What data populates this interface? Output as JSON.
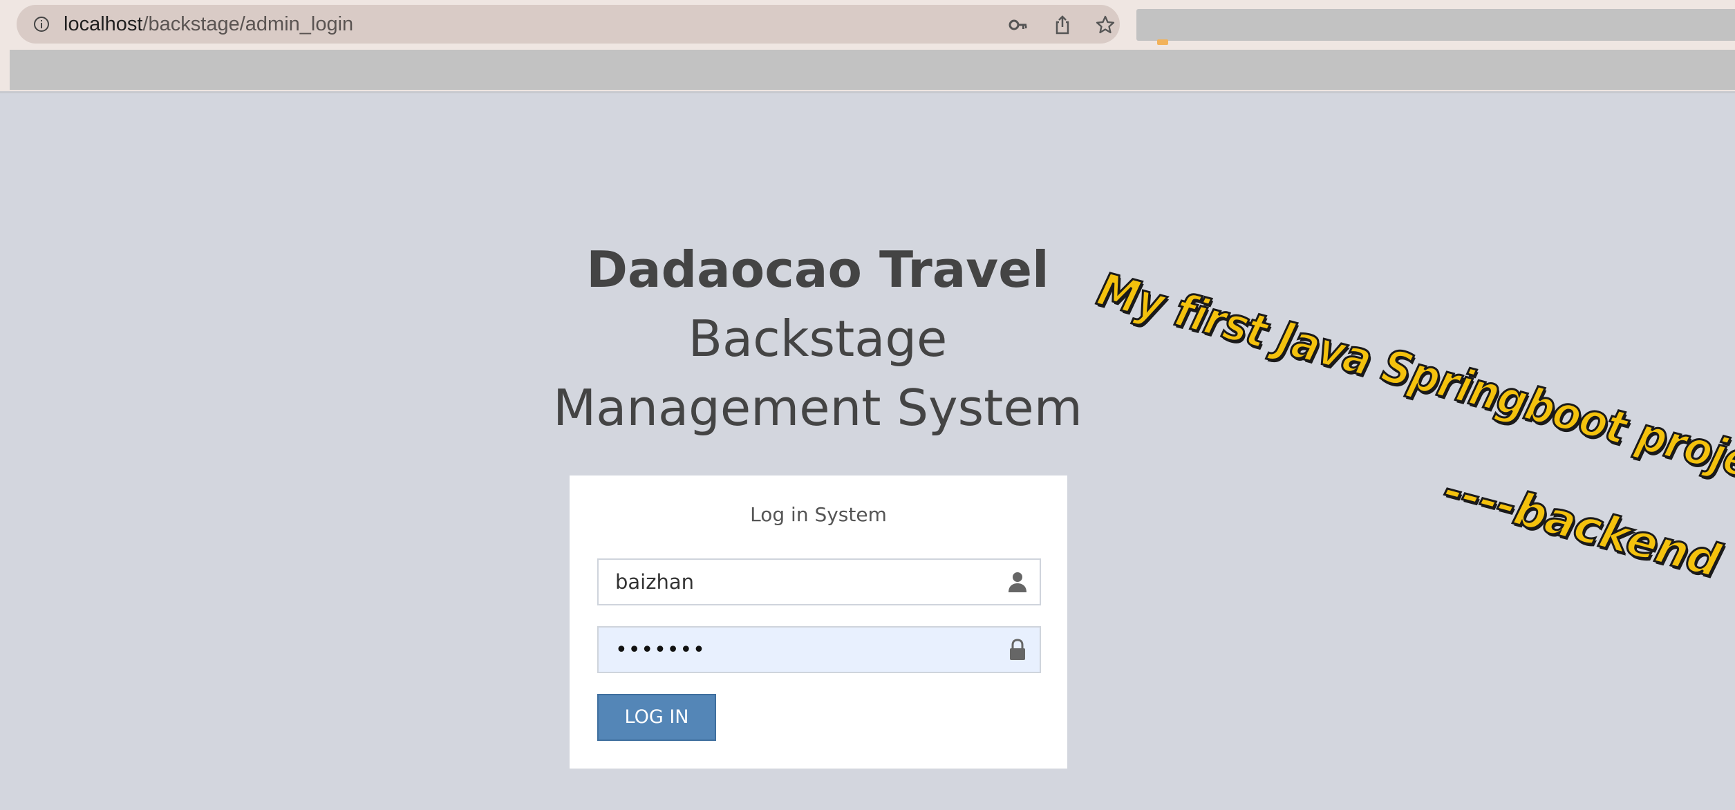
{
  "browser": {
    "url_host": "localhost",
    "url_path": "/backstage/admin_login"
  },
  "page": {
    "title_main": "Dadaocao Travel",
    "title_line2": "Backstage",
    "title_line3": "Management System"
  },
  "login": {
    "card_title": "Log in System",
    "username_value": "baizhan",
    "password_value": "1234567",
    "button_label": "LOG IN"
  },
  "overlay": {
    "banner": "My first Java Springboot project!",
    "signature": "----backend"
  },
  "colors": {
    "page_background": "#d3d6de",
    "button": "#5486b7",
    "autofill": "#e8f0fe",
    "overlay_text": "#f4c20d"
  },
  "icons": {
    "address_bar": [
      "info-icon",
      "key-icon",
      "share-icon",
      "star-icon"
    ],
    "username_field": "user-icon",
    "password_field": "lock-icon"
  }
}
